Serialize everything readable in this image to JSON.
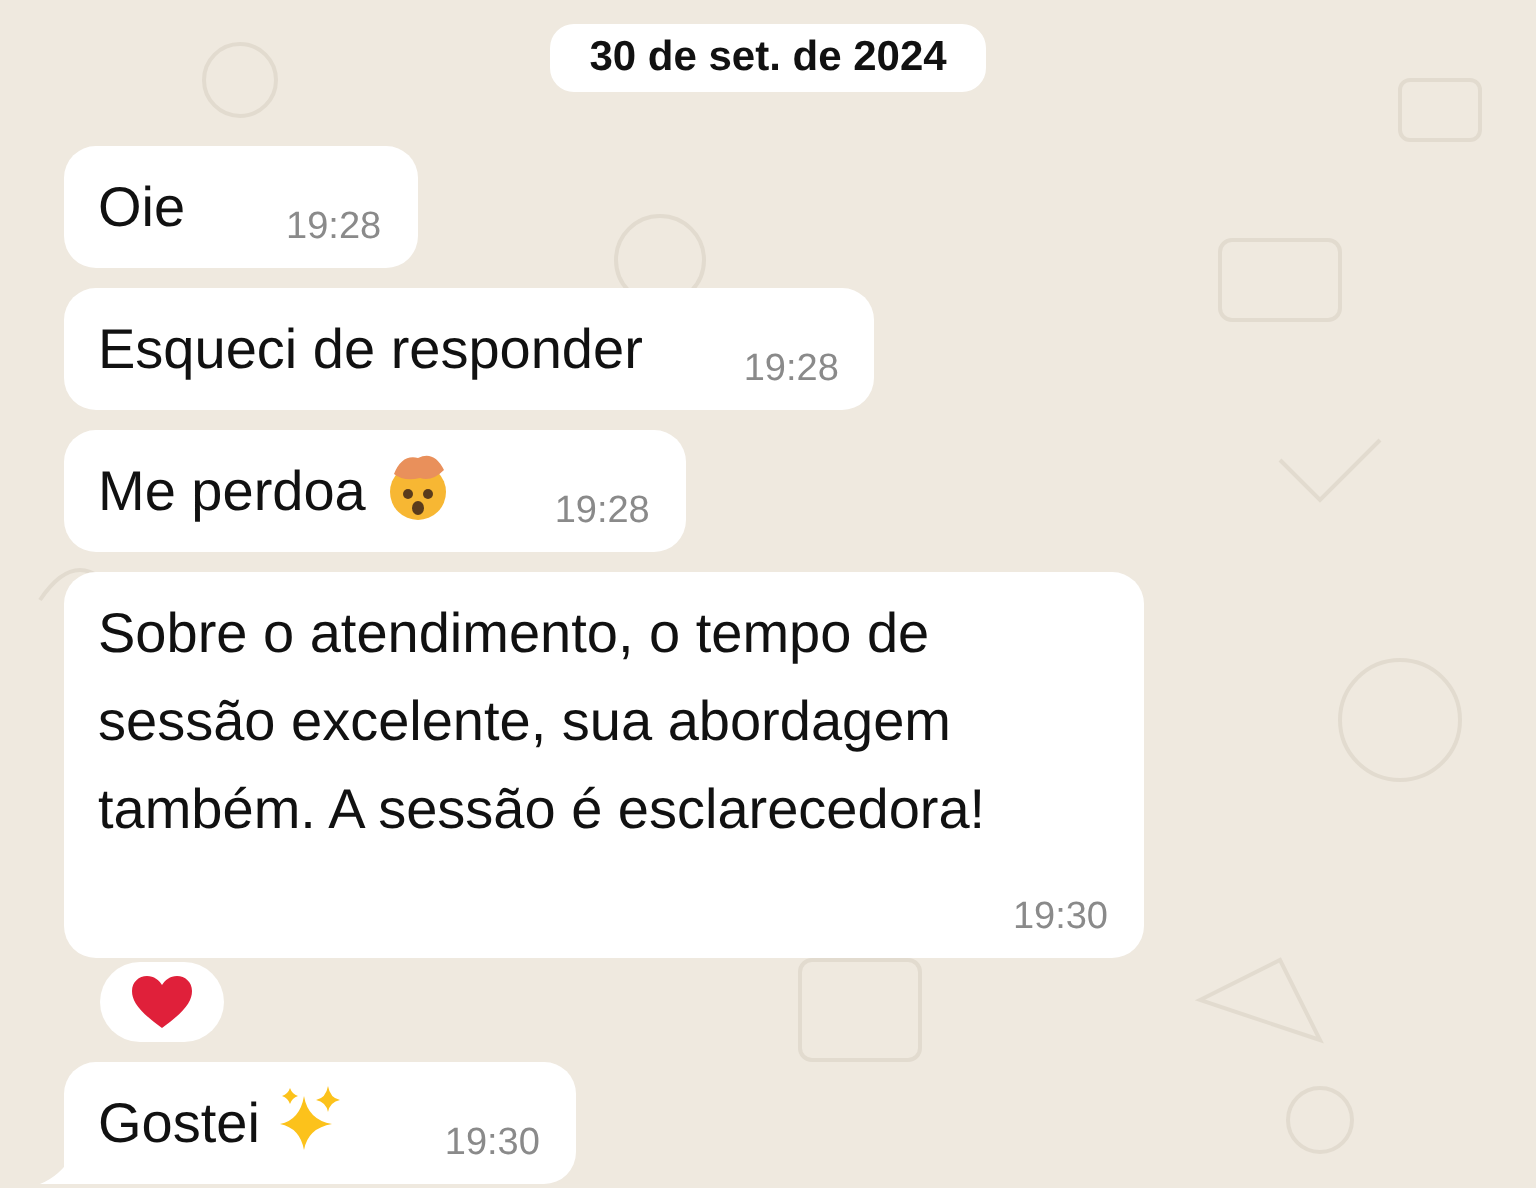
{
  "date_label": "30 de set. de 2024",
  "messages": [
    {
      "text": "Oie",
      "time": "19:28",
      "tail": false,
      "kind": "plain",
      "reaction": false
    },
    {
      "text": "Esqueci de responder",
      "time": "19:28",
      "tail": false,
      "kind": "plain",
      "reaction": false
    },
    {
      "text": "Me perdoa",
      "time": "19:28",
      "tail": false,
      "kind": "face",
      "reaction": false
    },
    {
      "text": "Sobre o atendimento, o tempo de sessão excelente, sua abordagem também. A sessão é esclarecedora!",
      "time": "19:30",
      "tail": false,
      "kind": "plain",
      "reaction": true
    },
    {
      "text": "Gostei",
      "time": "19:30",
      "tail": true,
      "kind": "sparkles",
      "reaction": false
    }
  ]
}
